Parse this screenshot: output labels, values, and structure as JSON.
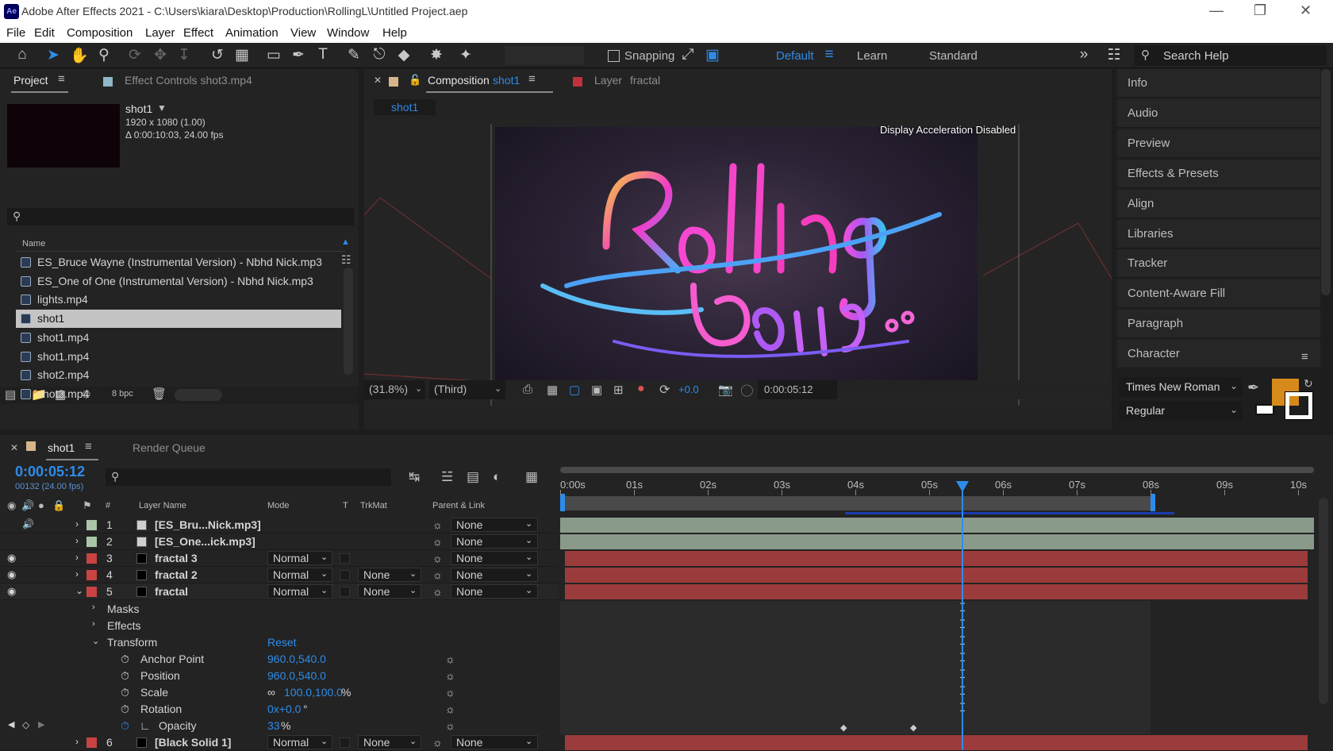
{
  "window": {
    "title": "Adobe After Effects 2021 - C:\\Users\\kiara\\Desktop\\Production\\RollingL\\Untitled Project.aep",
    "logo": "Ae"
  },
  "menu": [
    "File",
    "Edit",
    "Composition",
    "Layer",
    "Effect",
    "Animation",
    "View",
    "Window",
    "Help"
  ],
  "toolbar": {
    "snapping": "Snapping",
    "workspaces": [
      "Default",
      "Learn",
      "Standard"
    ],
    "search_placeholder": "Search Help"
  },
  "project": {
    "tab": "Project",
    "effect_tab": "Effect Controls shot3.mp4",
    "item_name": "shot1",
    "resolution": "1920 x 1080 (1.00)",
    "duration": "Δ 0:00:10:03, 24.00 fps",
    "column_name": "Name",
    "bpc": "8 bpc",
    "items": [
      "ES_Bruce Wayne (Instrumental Version) - Nbhd Nick.mp3",
      "ES_One of One (Instrumental Version) - Nbhd Nick.mp3",
      "lights.mp4",
      "shot1",
      "shot1.mp4",
      "shot1.mp4",
      "shot2.mp4",
      "shot3.mp4"
    ],
    "selected_index": 3
  },
  "comp": {
    "tab_prefix": "Composition",
    "tab_name": "shot1",
    "layer_tab_prefix": "Layer",
    "layer_tab_name": "fractal",
    "subtab": "shot1",
    "overlay": "Display Acceleration Disabled",
    "zoom": "(31.8%)",
    "resolution": "(Third)",
    "exposure": "+0.0",
    "timecode": "0:00:05:12"
  },
  "right_panels": [
    "Info",
    "Audio",
    "Preview",
    "Effects & Presets",
    "Align",
    "Libraries",
    "Tracker",
    "Content-Aware Fill",
    "Paragraph",
    "Character"
  ],
  "character": {
    "font": "Times New Roman",
    "style": "Regular",
    "fill_color": "#d78a1c"
  },
  "timeline": {
    "tab": "shot1",
    "render_queue": "Render Queue",
    "timecode": "0:00:05:12",
    "frames": "00132 (24.00 fps)",
    "columns": {
      "num": "#",
      "layer_name": "Layer Name",
      "mode": "Mode",
      "t": "T",
      "trkmat": "TrkMat",
      "parent": "Parent & Link"
    },
    "ruler": [
      "0:00s",
      "01s",
      "02s",
      "03s",
      "04s",
      "05s",
      "06s",
      "07s",
      "08s",
      "09s",
      "10s"
    ],
    "playhead_fraction": 0.545,
    "layers": [
      {
        "num": "1",
        "name": "[ES_Bru...Nick.mp3]",
        "color": "#a9c6a9",
        "mode": "",
        "trkmat": "",
        "parent": "None",
        "type": "audio"
      },
      {
        "num": "2",
        "name": "[ES_One...ick.mp3]",
        "color": "#a9c6a9",
        "mode": "",
        "trkmat": "",
        "parent": "None",
        "type": "audio"
      },
      {
        "num": "3",
        "name": "fractal 3",
        "color": "#c94343",
        "mode": "Normal",
        "trkmat": "",
        "parent": "None",
        "type": "solid"
      },
      {
        "num": "4",
        "name": "fractal 2",
        "color": "#c94343",
        "mode": "Normal",
        "trkmat": "None",
        "parent": "None",
        "type": "solid"
      },
      {
        "num": "5",
        "name": "fractal",
        "color": "#c94343",
        "mode": "Normal",
        "trkmat": "None",
        "parent": "None",
        "type": "solid"
      },
      {
        "num": "6",
        "name": "[Black Solid 1]",
        "color": "#c94343",
        "mode": "Normal",
        "trkmat": "None",
        "parent": "None",
        "type": "solid"
      }
    ],
    "props": {
      "masks": "Masks",
      "effects": "Effects",
      "transform": "Transform",
      "reset": "Reset",
      "anchor_label": "Anchor Point",
      "anchor_value": "960.0,540.0",
      "position_label": "Position",
      "position_value": "960.0,540.0",
      "scale_label": "Scale",
      "scale_value": "100.0,100.0",
      "scale_unit": "%",
      "rotation_label": "Rotation",
      "rotation_value": "0x+0.0",
      "rotation_unit": "°",
      "opacity_label": "Opacity",
      "opacity_value": "33",
      "opacity_unit": "%"
    }
  }
}
